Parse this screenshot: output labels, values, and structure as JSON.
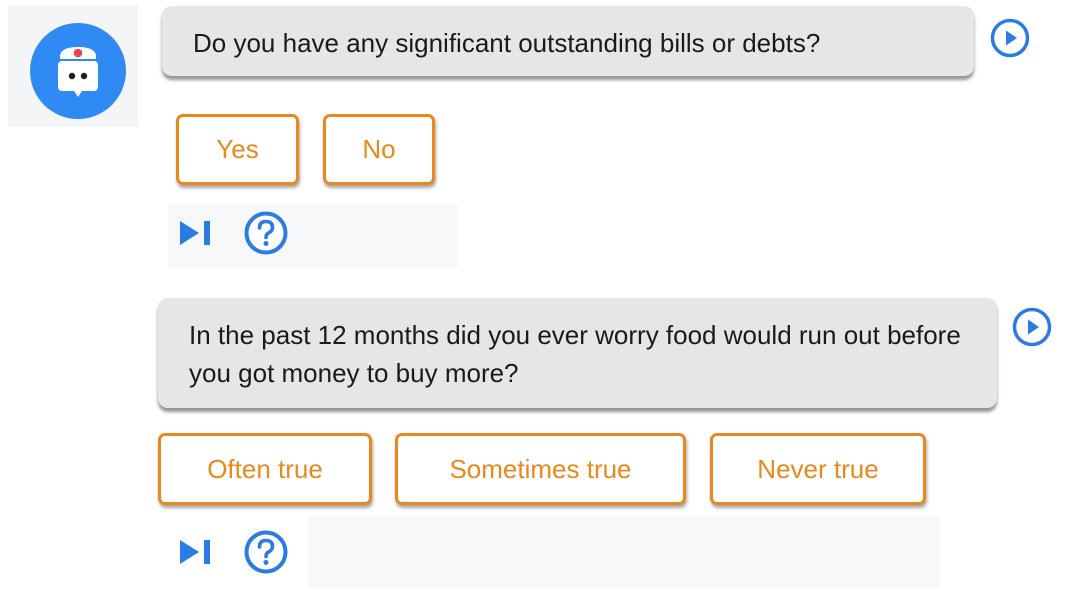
{
  "assistant": {
    "avatar_icon": "nurse-bot-icon"
  },
  "messages": [
    {
      "question": "Do you have any significant outstanding bills or debts?",
      "play_icon": "play-circle-icon",
      "answers": [
        "Yes",
        "No"
      ],
      "tools": {
        "skip_icon": "skip-icon",
        "help_icon": "help-circle-icon"
      }
    },
    {
      "question": "In the past 12 months did you ever worry food would run out before you got money to buy more?",
      "play_icon": "play-circle-icon",
      "answers": [
        "Often true",
        "Sometimes true",
        "Never true"
      ],
      "tools": {
        "skip_icon": "skip-icon",
        "help_icon": "help-circle-icon"
      }
    }
  ],
  "colors": {
    "accent_blue": "#2b7be5",
    "answer_orange": "#e8891d",
    "bubble_gray": "#e6e6e6",
    "avatar_blue": "#2f8bf3"
  }
}
